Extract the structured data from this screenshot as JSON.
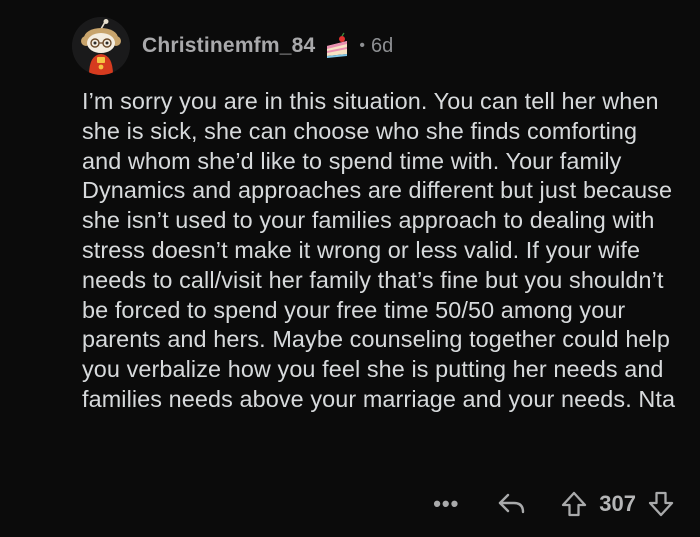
{
  "comment": {
    "username": "Christinemfm_84",
    "separator": "•",
    "age": "6d",
    "avatar_icon": "snoo-avatar-icon",
    "flair_icon": "cake-icon",
    "body": "I’m sorry you are in this situation. You can tell her when she is sick, she can choose who she finds comforting and whom she’d like to spend time with. Your family Dynamics and approaches are different but just because she isn’t used to your families approach to dealing with stress doesn’t make it wrong or less valid. If your wife needs to call/visit her family that’s fine but you shouldn’t be forced to spend your free time 50/50 among your parents and hers. Maybe counseling together could help you verbalize how you feel she is putting her needs and families needs above your marriage and your needs. Nta",
    "actions": {
      "more_label": "•••",
      "score": "307"
    }
  },
  "colors": {
    "background": "#0b0b0b",
    "text": "#d7dadc",
    "muted": "#8d8f92"
  }
}
